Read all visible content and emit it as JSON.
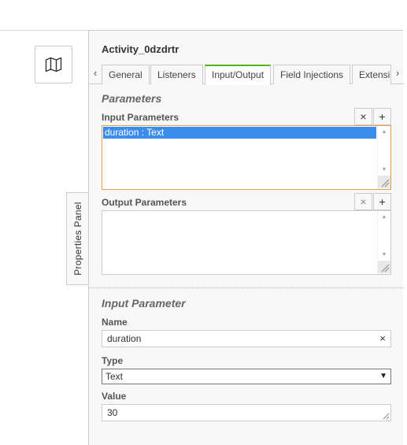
{
  "canvas": {
    "map_icon": "map-icon"
  },
  "panel": {
    "toggle_label": "Properties Panel",
    "title": "Activity_0dzdrtr",
    "tabs": [
      {
        "label": "General"
      },
      {
        "label": "Listeners"
      },
      {
        "label": "Input/Output"
      },
      {
        "label": "Field Injections"
      },
      {
        "label": "Extensions"
      }
    ],
    "active_tab": "Input/Output",
    "prev_arrow": "‹",
    "next_arrow": "›",
    "parameters_group": {
      "title": "Parameters",
      "input_parameters": {
        "label": "Input Parameters",
        "remove_label": "×",
        "add_label": "+",
        "items": [
          "duration : Text"
        ],
        "selected_item": "duration : Text"
      },
      "output_parameters": {
        "label": "Output Parameters",
        "remove_label": "×",
        "add_label": "+",
        "items": []
      }
    },
    "input_parameter_group": {
      "title": "Input Parameter",
      "name_label": "Name",
      "name_value": "duration",
      "clear_label": "×",
      "type_label": "Type",
      "type_value": "Text",
      "value_label": "Value",
      "value_value": "30"
    }
  },
  "colors": {
    "active_tab_accent": "#52b415",
    "selection": "#3b8ded",
    "focus_border": "#e0a050"
  }
}
